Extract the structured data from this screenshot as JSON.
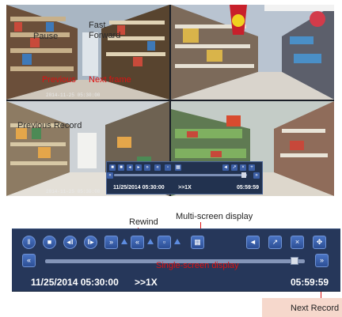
{
  "camera_grid": {
    "cameras": [
      {
        "caption": "2014-11-25 05:30:00"
      },
      {
        "caption": ""
      },
      {
        "caption": "2014-11-25 05:30:00"
      },
      {
        "caption": ""
      }
    ],
    "labels": {
      "fast_forward_1": "Fast",
      "fast_forward_2": "Forward",
      "rewind_behind": "Pause",
      "previous_frame": "Previous",
      "next_frame": "Next frame",
      "previous_record": "Previous Record"
    }
  },
  "mini_panel": {
    "date": "11/25/2014 05:30:00",
    "speed": ">>1X",
    "time": "05:59:59"
  },
  "annotations": {
    "rewind": "Rewind",
    "multi_screen": "Multi-screen display",
    "single_screen": "Single-screen display",
    "next_record": "Next Record"
  },
  "panel": {
    "date": "11/25/2014 05:30:00",
    "speed": ">>1X",
    "time": "05:59:59",
    "progress_fraction": 0.96
  },
  "colors": {
    "panel_bg": "#26375a",
    "button": "#3c62ad",
    "annotation_red": "#dd1111",
    "next_record_bg": "#f6d8cc"
  },
  "icons": [
    "play-icon",
    "stop-icon",
    "step-back-icon",
    "step-forward-icon",
    "fast-forward-icon",
    "rewind-icon",
    "single-screen-icon",
    "multi-screen-icon",
    "volume-icon",
    "prev-record-icon",
    "next-record-icon"
  ]
}
